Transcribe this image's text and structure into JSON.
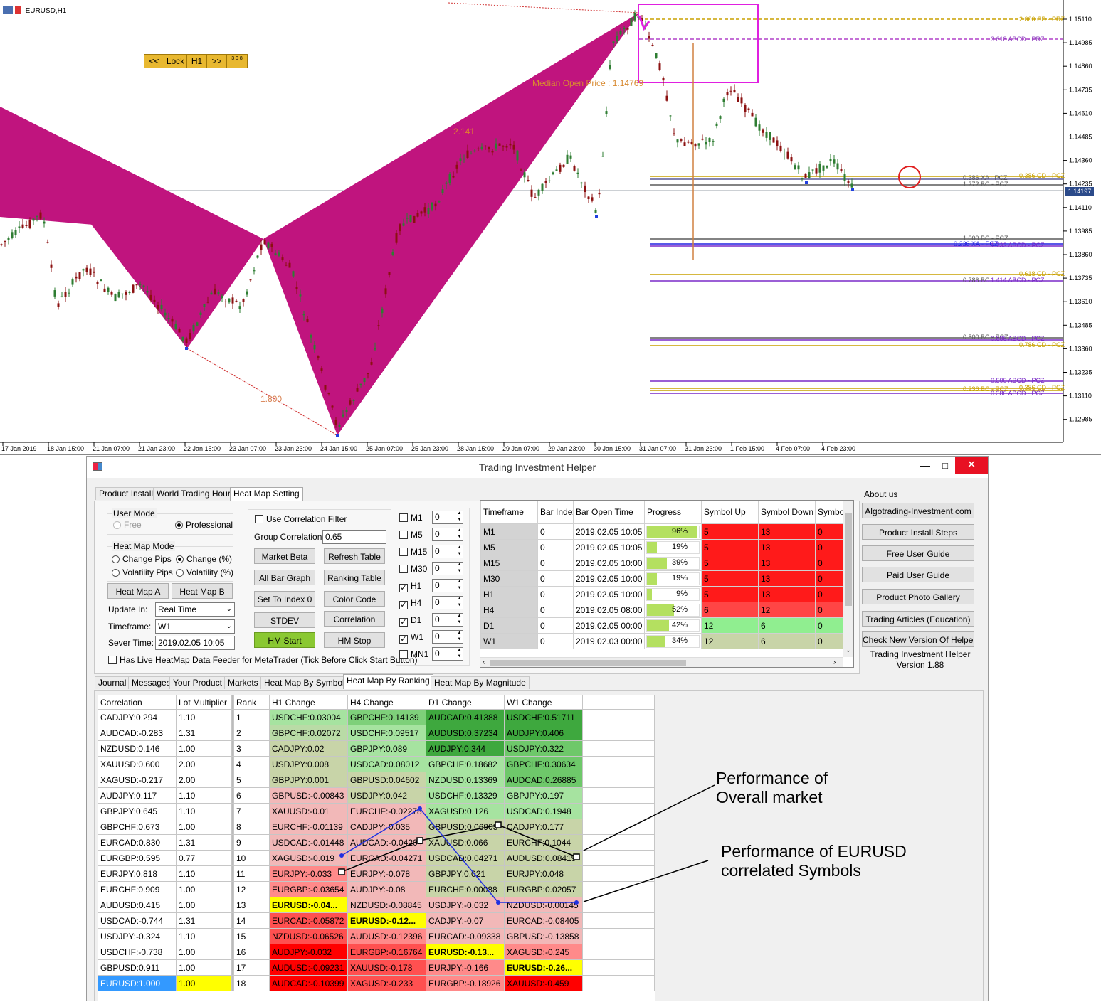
{
  "chart": {
    "symbol": "EURUSD,H1",
    "nav_buttons": [
      "<<",
      "Lock",
      "H1",
      ">>",
      "3 0 8"
    ],
    "median_label": "Median Open Price : 1.14769",
    "ratio_labels": [
      "2.141",
      "1.800"
    ],
    "current_price": "1.14197",
    "price_ticks": [
      "1.15110",
      "1.14985",
      "1.14860",
      "1.14735",
      "1.14610",
      "1.14485",
      "1.14360",
      "1.14235",
      "1.14110",
      "1.13985",
      "1.13860",
      "1.13735",
      "1.13610",
      "1.13485",
      "1.13360",
      "1.13235",
      "1.13110",
      "1.12985"
    ],
    "time_ticks": [
      "17 Jan 2019",
      "18 Jan 15:00",
      "21 Jan 07:00",
      "21 Jan 23:00",
      "22 Jan 15:00",
      "23 Jan 07:00",
      "23 Jan 23:00",
      "24 Jan 15:00",
      "25 Jan 07:00",
      "25 Jan 23:00",
      "28 Jan 15:00",
      "29 Jan 07:00",
      "29 Jan 23:00",
      "30 Jan 15:00",
      "31 Jan 07:00",
      "31 Jan 23:00",
      "1 Feb 15:00",
      "4 Feb 07:00",
      "4 Feb 23:00"
    ],
    "level_labels": [
      "2.000 CD - PRZ",
      "3.618 ABCD - PRZ",
      "0.386 XA - PCZ",
      "0.386 CD - PCZ",
      "1.272 BC - PCZ",
      "1.000 BC - PCZ",
      "0.236 XA - PCZ",
      "1.732 ABCD - PCZ",
      "0.618 CD - PCZ",
      "0.786 BC",
      "1.414 ABCD - PCZ",
      "0.500 BC - PCZ",
      "0.886 ABCD - PCZ",
      "0.786 CD - PCZ",
      "0.500 ABCD - PCZ",
      "0.236 BC - PCZ",
      "0.386 CD - PCZ",
      "0.386 ABCD - PCZ"
    ],
    "colors": {
      "pattern": "#c0147e",
      "prz_box": "#e020e0",
      "gold": "#c8a000",
      "purple": "#7a2ac8",
      "blue": "#2020e0",
      "up_candle": "#2e7d32",
      "down_candle": "#8b1010"
    }
  },
  "window": {
    "title": "Trading Investment Helper",
    "top_tabs": [
      "Product Install",
      "World Trading Hours",
      "Heat Map Setting"
    ],
    "user_mode_label": "User Mode",
    "user_mode_free": "Free",
    "user_mode_pro": "Professional",
    "heatmap_mode_label": "Heat Map Mode",
    "mode_change_pips": "Change Pips",
    "mode_change_pct": "Change (%)",
    "mode_vol_pips": "Volatility Pips",
    "mode_vol_pct": "Volatility (%)",
    "btn_heatmap_a": "Heat Map A",
    "btn_heatmap_b": "Heat Map B",
    "update_label": "Update In:",
    "update_value": "Real Time",
    "timeframe_label": "Timeframe:",
    "timeframe_value": "W1",
    "server_time_label": "Sever Time:",
    "server_time_value": "2019.02.05 10:05",
    "live_feeder_label": "Has Live HeatMap Data Feeder for MetaTrader (Tick Before Click Start Button)",
    "use_corr_filter": "Use Correlation Filter",
    "group_corr_label": "Group Correlation:",
    "group_corr_value": "0.65",
    "btn_market_beta": "Market Beta",
    "btn_refresh_table": "Refresh Table",
    "btn_all_bar_graph": "All Bar Graph",
    "btn_ranking_table": "Ranking Table",
    "btn_set_index": "Set To Index 0",
    "btn_color_code": "Color Code",
    "btn_stdev": "STDEV",
    "btn_correlation": "Correlation",
    "btn_hm_start": "HM Start",
    "btn_hm_stop": "HM Stop",
    "tf_checks": [
      {
        "label": "M1",
        "checked": false,
        "value": "0"
      },
      {
        "label": "M5",
        "checked": false,
        "value": "0"
      },
      {
        "label": "M15",
        "checked": false,
        "value": "0"
      },
      {
        "label": "M30",
        "checked": false,
        "value": "0"
      },
      {
        "label": "H1",
        "checked": true,
        "value": "0"
      },
      {
        "label": "H4",
        "checked": true,
        "value": "0"
      },
      {
        "label": "D1",
        "checked": true,
        "value": "0"
      },
      {
        "label": "W1",
        "checked": true,
        "value": "0"
      },
      {
        "label": "MN1",
        "checked": false,
        "value": "0"
      }
    ],
    "tf_table": {
      "headers": [
        "Timeframe",
        "Bar Index",
        "Bar Open Time",
        "Progress",
        "Symbol Up",
        "Symbol Down",
        "Symbol Neutral"
      ],
      "rows": [
        {
          "tf": "M1",
          "idx": "0",
          "time": "2019.02.05 10:05",
          "progress": 96,
          "progress_label": "96%",
          "up": "5",
          "down": "13",
          "neutral": "0",
          "color": "red"
        },
        {
          "tf": "M5",
          "idx": "0",
          "time": "2019.02.05 10:05",
          "progress": 19,
          "progress_label": "19%",
          "up": "5",
          "down": "13",
          "neutral": "0",
          "color": "red"
        },
        {
          "tf": "M15",
          "idx": "0",
          "time": "2019.02.05 10:00",
          "progress": 39,
          "progress_label": "39%",
          "up": "5",
          "down": "13",
          "neutral": "0",
          "color": "red"
        },
        {
          "tf": "M30",
          "idx": "0",
          "time": "2019.02.05 10:00",
          "progress": 19,
          "progress_label": "19%",
          "up": "5",
          "down": "13",
          "neutral": "0",
          "color": "red"
        },
        {
          "tf": "H1",
          "idx": "0",
          "time": "2019.02.05 10:00",
          "progress": 9,
          "progress_label": "9%",
          "up": "5",
          "down": "13",
          "neutral": "0",
          "color": "red"
        },
        {
          "tf": "H4",
          "idx": "0",
          "time": "2019.02.05 08:00",
          "progress": 52,
          "progress_label": "52%",
          "up": "6",
          "down": "12",
          "neutral": "0",
          "color": "lightred"
        },
        {
          "tf": "D1",
          "idx": "0",
          "time": "2019.02.05 00:00",
          "progress": 42,
          "progress_label": "42%",
          "up": "12",
          "down": "6",
          "neutral": "0",
          "color": "green"
        },
        {
          "tf": "W1",
          "idx": "0",
          "time": "2019.02.03 00:00",
          "progress": 34,
          "progress_label": "34%",
          "up": "12",
          "down": "6",
          "neutral": "0",
          "color": "olive"
        }
      ]
    },
    "about_label": "About us",
    "about_buttons": [
      "Algotrading-Investment.com",
      "Product Install Steps",
      "Free User Guide",
      "Paid User Guide",
      "Product Photo Gallery",
      "Trading Articles (Education)",
      "Check New Version Of Helper"
    ],
    "version_line1": "Trading Investment Helper",
    "version_line2": "Version 1.88",
    "bottom_tabs": [
      "Journal",
      "Messages",
      "Your Product",
      "Markets",
      "Heat Map By Symbol",
      "Heat Map By Ranking",
      "Heat Map By Magnitude"
    ],
    "ranking": {
      "headers": [
        "Correlation",
        "Lot Multiplier",
        "Rank",
        "H1 Change",
        "H4 Change",
        "D1 Change",
        "W1 Change"
      ],
      "corr": [
        [
          "CADJPY:0.294",
          "1.10"
        ],
        [
          "AUDCAD:-0.283",
          "1.31"
        ],
        [
          "NZDUSD:0.146",
          "1.00"
        ],
        [
          "XAUUSD:0.600",
          "2.00"
        ],
        [
          "XAGUSD:-0.217",
          "2.00"
        ],
        [
          "AUDJPY:0.117",
          "1.10"
        ],
        [
          "GBPJPY:0.645",
          "1.10"
        ],
        [
          "GBPCHF:0.673",
          "1.00"
        ],
        [
          "EURCAD:0.830",
          "1.31"
        ],
        [
          "EURGBP:0.595",
          "0.77"
        ],
        [
          "EURJPY:0.818",
          "1.10"
        ],
        [
          "EURCHF:0.909",
          "1.00"
        ],
        [
          "AUDUSD:0.415",
          "1.00"
        ],
        [
          "USDCAD:-0.744",
          "1.31"
        ],
        [
          "USDJPY:-0.324",
          "1.10"
        ],
        [
          "USDCHF:-0.738",
          "1.00"
        ],
        [
          "GBPUSD:0.911",
          "1.00"
        ],
        [
          "EURUSD:1.000",
          "1.00"
        ]
      ],
      "rows": [
        [
          "USDCHF:0.03004",
          "GBPCHF:0.14139",
          "AUDCAD:0.41388",
          "USDCHF:0.51711"
        ],
        [
          "GBPCHF:0.02072",
          "USDCHF:0.09517",
          "AUDUSD:0.37234",
          "AUDJPY:0.406"
        ],
        [
          "CADJPY:0.02",
          "GBPJPY:0.089",
          "AUDJPY:0.344",
          "USDJPY:0.322"
        ],
        [
          "USDJPY:0.008",
          "USDCAD:0.08012",
          "GBPCHF:0.18682",
          "GBPCHF:0.30634"
        ],
        [
          "GBPJPY:0.001",
          "GBPUSD:0.04602",
          "NZDUSD:0.13369",
          "AUDCAD:0.26885"
        ],
        [
          "GBPUSD:-0.00843",
          "USDJPY:0.042",
          "USDCHF:0.13329",
          "GBPJPY:0.197"
        ],
        [
          "XAUUSD:-0.01",
          "EURCHF:-0.02278",
          "XAGUSD:0.126",
          "USDCAD:0.1948"
        ],
        [
          "EURCHF:-0.01139",
          "CADJPY:-0.035",
          "GBPUSD:0.06905",
          "CADJPY:0.177"
        ],
        [
          "USDCAD:-0.01448",
          "AUDCAD:-0.04204",
          "XAUUSD:0.066",
          "EURCHF:0.1044"
        ],
        [
          "XAGUSD:-0.019",
          "EURCAD:-0.04271",
          "USDCAD:0.04271",
          "AUDUSD:0.08419"
        ],
        [
          "EURJPY:-0.033",
          "EURJPY:-0.078",
          "GBPJPY:0.021",
          "EURJPY:0.048"
        ],
        [
          "EURGBP:-0.03654",
          "AUDJPY:-0.08",
          "EURCHF:0.00088",
          "EURGBP:0.02057"
        ],
        [
          "EURUSD:-0.04...",
          "NZDUSD:-0.08845",
          "USDJPY:-0.032",
          "NZDUSD:-0.00145"
        ],
        [
          "EURCAD:-0.05872",
          "EURUSD:-0.12...",
          "CADJPY:-0.07",
          "EURCAD:-0.08405"
        ],
        [
          "NZDUSD:-0.06526",
          "AUDUSD:-0.12396",
          "EURCAD:-0.09338",
          "GBPUSD:-0.13858"
        ],
        [
          "AUDJPY:-0.032",
          "EURGBP:-0.16764",
          "EURUSD:-0.13...",
          "XAGUSD:-0.245"
        ],
        [
          "AUDUSD:-0.09231",
          "XAUUSD:-0.178",
          "EURJPY:-0.166",
          "EURUSD:-0.26..."
        ],
        [
          "AUDCAD:-0.10399",
          "XAGUSD:-0.233",
          "EURGBP:-0.18926",
          "XAUUSD:-0.459"
        ]
      ]
    }
  },
  "annotations": {
    "overall_line1": "Performance of",
    "overall_line2": "Overall market",
    "eurusd_line1": "Performance of EURUSD",
    "eurusd_line2": "correlated Symbols"
  }
}
